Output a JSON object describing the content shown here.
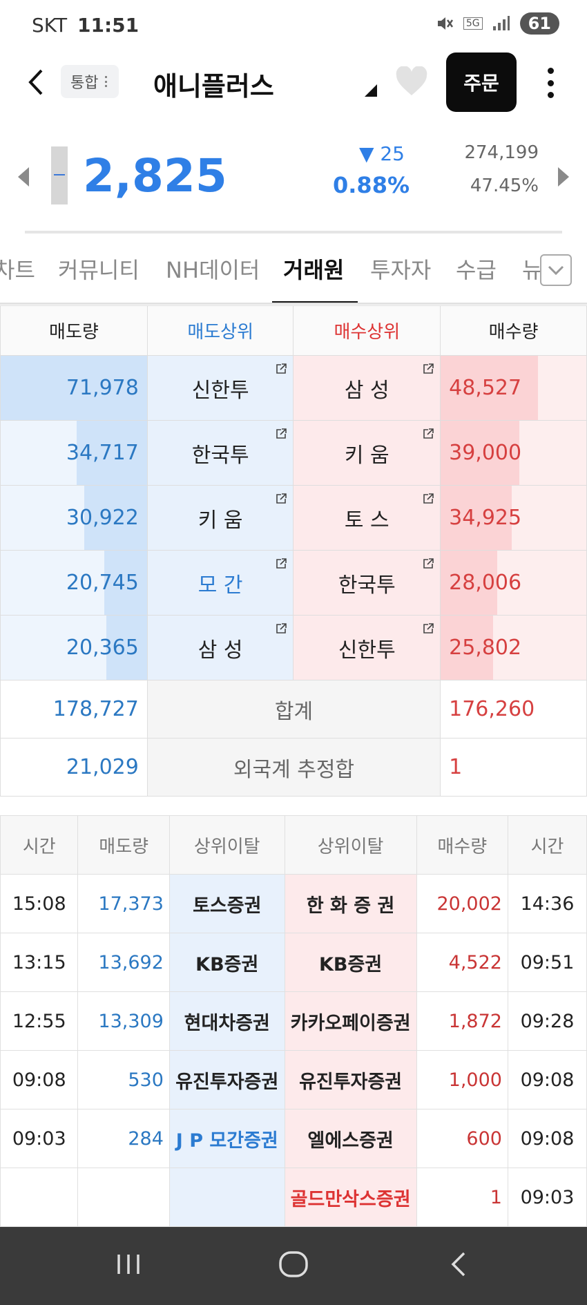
{
  "status": {
    "carrier": "SKT",
    "time": "11:51",
    "battery": "61",
    "network": "5G"
  },
  "header": {
    "back_icon": "chevron-left-icon",
    "tag": "통합",
    "stock_name": "애니플러스",
    "order_label": "주문"
  },
  "quote": {
    "price": "2,825",
    "change": "▼ 25",
    "change_pct": "0.88%",
    "volume": "274,199",
    "ratio": "47.45%",
    "color": "#2f7fe6"
  },
  "tabs": [
    "차트",
    "커뮤니티",
    "NH데이터",
    "거래원",
    "투자자",
    "수급",
    "뉴"
  ],
  "active_tab": "거래원",
  "brokers": {
    "headers": {
      "sell_qty": "매도량",
      "sell_top": "매도상위",
      "buy_top": "매수상위",
      "buy_qty": "매수량"
    },
    "rows": [
      {
        "sell_qty": "71,978",
        "sell_broker": "신한투",
        "buy_broker": "삼 성",
        "buy_qty": "48,527",
        "sell_frac": 1.0,
        "buy_frac": 0.67
      },
      {
        "sell_qty": "34,717",
        "sell_broker": "한국투",
        "buy_broker": "키 움",
        "buy_qty": "39,000",
        "sell_frac": 0.48,
        "buy_frac": 0.54
      },
      {
        "sell_qty": "30,922",
        "sell_broker": "키 움",
        "buy_broker": "토 스",
        "buy_qty": "34,925",
        "sell_frac": 0.43,
        "buy_frac": 0.49
      },
      {
        "sell_qty": "20,745",
        "sell_broker": "모 간",
        "buy_broker": "한국투",
        "buy_qty": "28,006",
        "sell_frac": 0.29,
        "buy_frac": 0.39
      },
      {
        "sell_qty": "20,365",
        "sell_broker": "삼 성",
        "buy_broker": "신한투",
        "buy_qty": "25,802",
        "sell_frac": 0.28,
        "buy_frac": 0.36
      }
    ],
    "total": {
      "label": "합계",
      "sell": "178,727",
      "buy": "176,260"
    },
    "foreign": {
      "label": "외국계 추정합",
      "sell": "21,029",
      "buy": "1"
    }
  },
  "deviations": {
    "headers": [
      "시간",
      "매도량",
      "상위이탈",
      "상위이탈",
      "매수량",
      "시간"
    ],
    "rows": [
      {
        "s_time": "15:08",
        "s_qty": "17,373",
        "s_broker": "토스증권",
        "b_broker": "한 화 증 권",
        "b_qty": "20,002",
        "b_time": "14:36"
      },
      {
        "s_time": "13:15",
        "s_qty": "13,692",
        "s_broker": "KB증권",
        "b_broker": "KB증권",
        "b_qty": "4,522",
        "b_time": "09:51"
      },
      {
        "s_time": "12:55",
        "s_qty": "13,309",
        "s_broker": "현대차증권",
        "b_broker": "카카오페이증권",
        "b_qty": "1,872",
        "b_time": "09:28"
      },
      {
        "s_time": "09:08",
        "s_qty": "530",
        "s_broker": "유진투자증권",
        "b_broker": "유진투자증권",
        "b_qty": "1,000",
        "b_time": "09:08"
      },
      {
        "s_time": "09:03",
        "s_qty": "284",
        "s_broker": "J P 모간증권",
        "b_broker": "엘에스증권",
        "b_qty": "600",
        "b_time": "09:08"
      },
      {
        "s_time": "",
        "s_qty": "",
        "s_broker": "",
        "b_broker": "골드만삭스증권",
        "b_qty": "1",
        "b_time": "09:03"
      }
    ]
  }
}
